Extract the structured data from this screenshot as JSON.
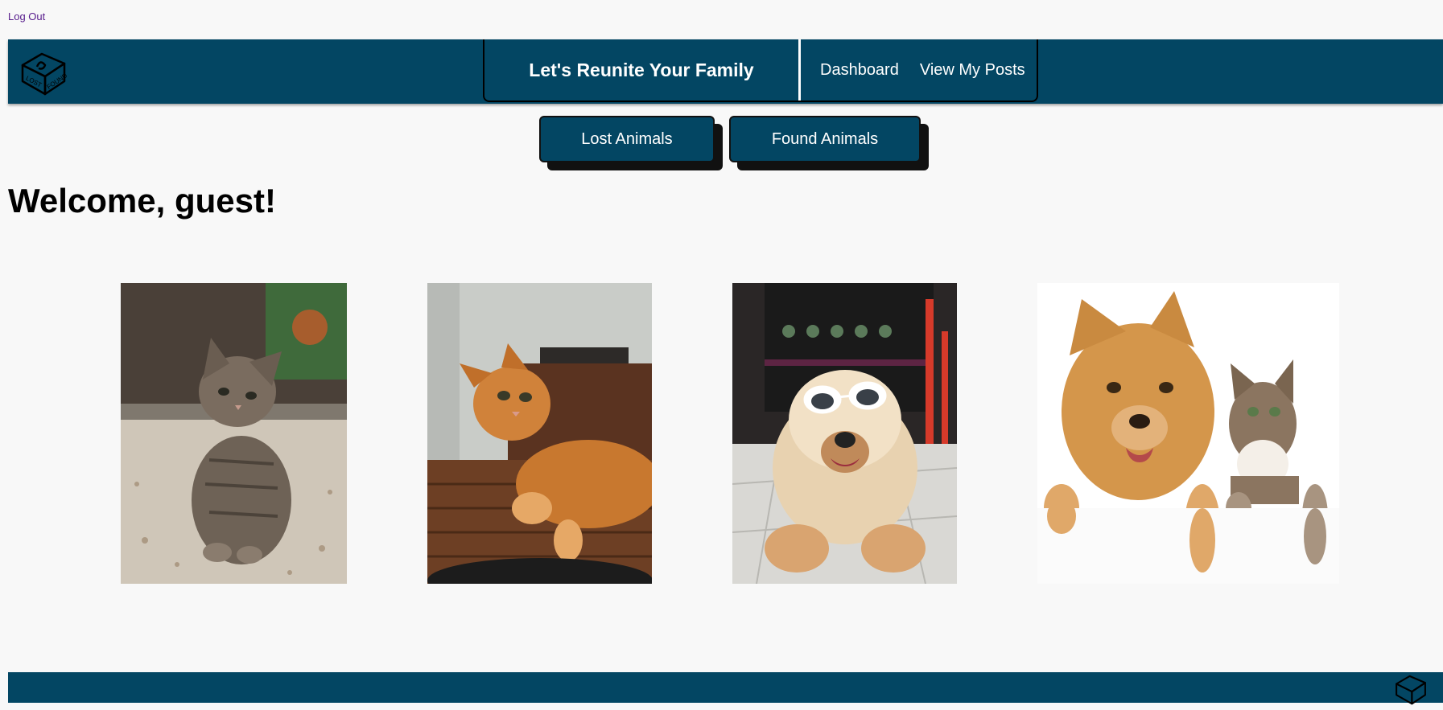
{
  "top": {
    "logout_label": "Log Out"
  },
  "header": {
    "logo_icon": "lost-found-box-logo",
    "title": "Let's Reunite Your Family",
    "nav": [
      {
        "label": "Dashboard"
      },
      {
        "label": "View My Posts"
      }
    ]
  },
  "tabs": [
    {
      "label": "Lost Animals"
    },
    {
      "label": "Found Animals"
    }
  ],
  "main": {
    "welcome": "Welcome, guest!"
  },
  "pets": [
    {
      "icon": "tabby-kitten-photo"
    },
    {
      "icon": "orange-cat-photo"
    },
    {
      "icon": "dog-with-sunglasses-photo"
    },
    {
      "icon": "dog-and-cat-photo"
    }
  ],
  "footer": {
    "logo_icon": "lost-found-box-logo"
  },
  "colors": {
    "brand": "#034663",
    "background": "#f8f8f8",
    "link": "#551a8b"
  }
}
